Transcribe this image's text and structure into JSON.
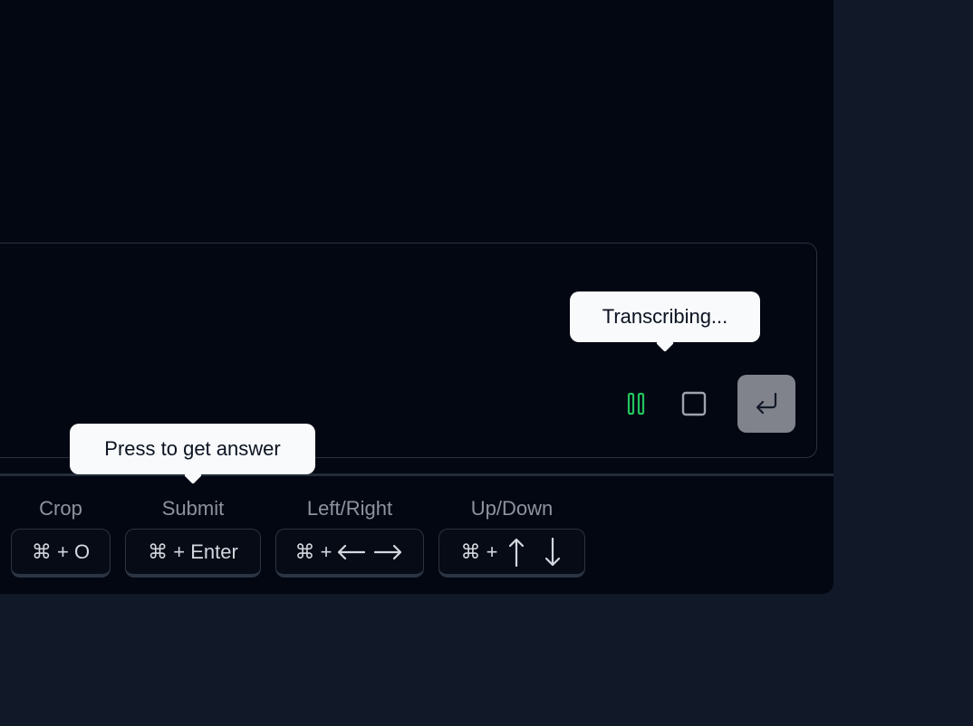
{
  "tooltips": {
    "transcribing": "Transcribing...",
    "answer": "Press to get answer"
  },
  "controls": {
    "pause_icon": "pause-icon",
    "stop_icon": "stop-icon",
    "enter_icon": "enter-return-icon",
    "pause_color": "#22c55e",
    "enter_bg": "#80838c"
  },
  "shortcuts": [
    {
      "label": "Crop",
      "keys": "⌘ + O"
    },
    {
      "label": "Submit",
      "keys": "⌘ + Enter"
    },
    {
      "label": "Left/Right",
      "keys": "⌘ +",
      "icons": [
        "arrow-left-icon",
        "arrow-right-icon"
      ]
    },
    {
      "label": "Up/Down",
      "keys": "⌘ +",
      "icons": [
        "arrow-up-icon",
        "arrow-down-icon"
      ]
    }
  ]
}
